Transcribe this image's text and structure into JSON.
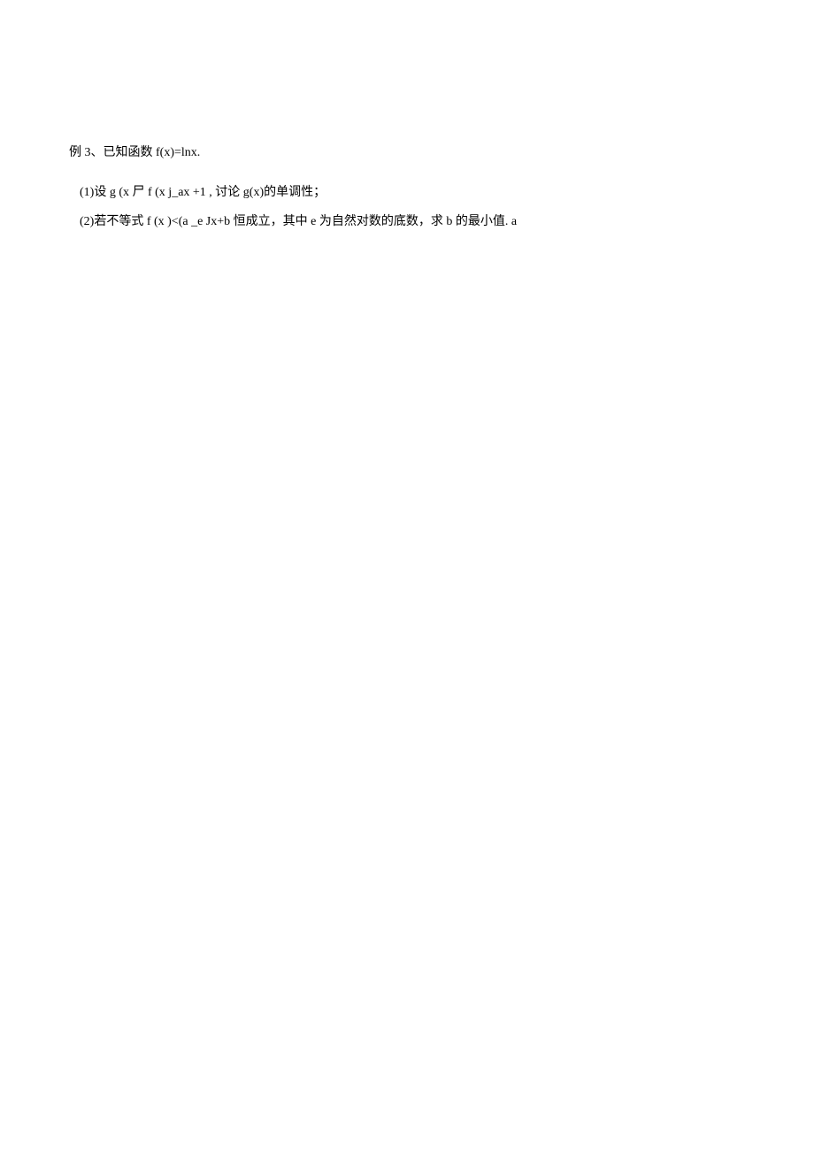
{
  "problem": {
    "title": "例 3、已知函数  f(x)=lnx.",
    "part1": "(1)设  g (x 尸  f (x j_ax +1 , 讨论 g(x)的单调性；",
    "part2": "(2)若不等式 f (x )<(a _e Jx+b 恒成立，其中 e 为自然对数的底数，求  b 的最小值.   a"
  }
}
